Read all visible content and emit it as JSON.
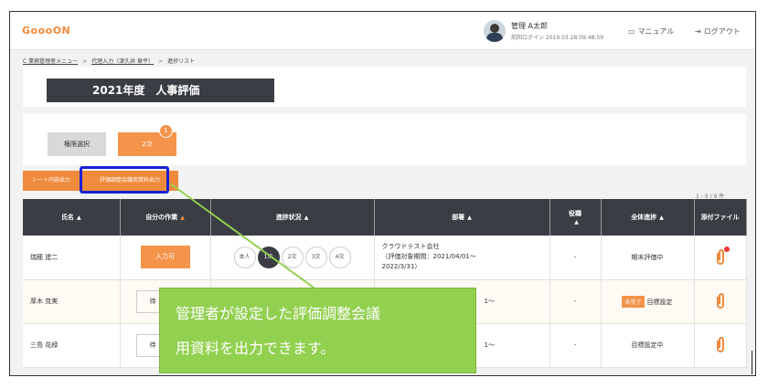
{
  "header": {
    "logo": "GoooON",
    "user_name": "管理 A太郎",
    "last_login": "前回ログイン 2019.03.28 09:48:59",
    "manual_label": "マニュアル",
    "logout_label": "ログアウト"
  },
  "breadcrumb": [
    "C 業務管理者メニュー",
    "代理入力（津久井 章平）",
    "進捗リスト"
  ],
  "page_title": "2021年度　人事評価",
  "tabs": {
    "scope_label": "権限選択",
    "second_label": "2次",
    "second_badge": "1"
  },
  "actions": {
    "sheet_output": "シート内容出力",
    "eval_output": "評価調整会議用資料出力"
  },
  "table": {
    "count": "1 - 9 / 9 件",
    "headers": [
      "氏名",
      "自分の作業",
      "進捗状況",
      "部署",
      "役職",
      "全体進捗",
      "添付ファイル"
    ],
    "rows": [
      {
        "name": "瑞穂 建二",
        "task": "入力可",
        "steps": [
          "本人",
          "1次",
          "2次",
          "3次",
          "4次"
        ],
        "dept_lines": [
          "クラウドテスト会社",
          "（評価対象期間：2021/04/01～",
          "2022/3/31）"
        ],
        "position": "-",
        "progress": "期末評価中",
        "progress_badge": ""
      },
      {
        "name": "厚木 克実",
        "task": "待",
        "steps": [],
        "dept_lines": [
          "1～"
        ],
        "position": "-",
        "progress": "目標設定",
        "progress_badge": "未完了"
      },
      {
        "name": "三島 花緑",
        "task": "待",
        "steps": [],
        "dept_lines": [
          "1～"
        ],
        "position": "-",
        "progress": "目標設定中",
        "progress_badge": ""
      }
    ]
  },
  "callout": {
    "line1": "管理者が設定した評価調整会議",
    "line2": "用資料を出力できます。"
  },
  "colors": {
    "accent": "#f3944a",
    "dark": "#3a3e44",
    "highlight": "#1523d6",
    "callout": "#92d050"
  }
}
